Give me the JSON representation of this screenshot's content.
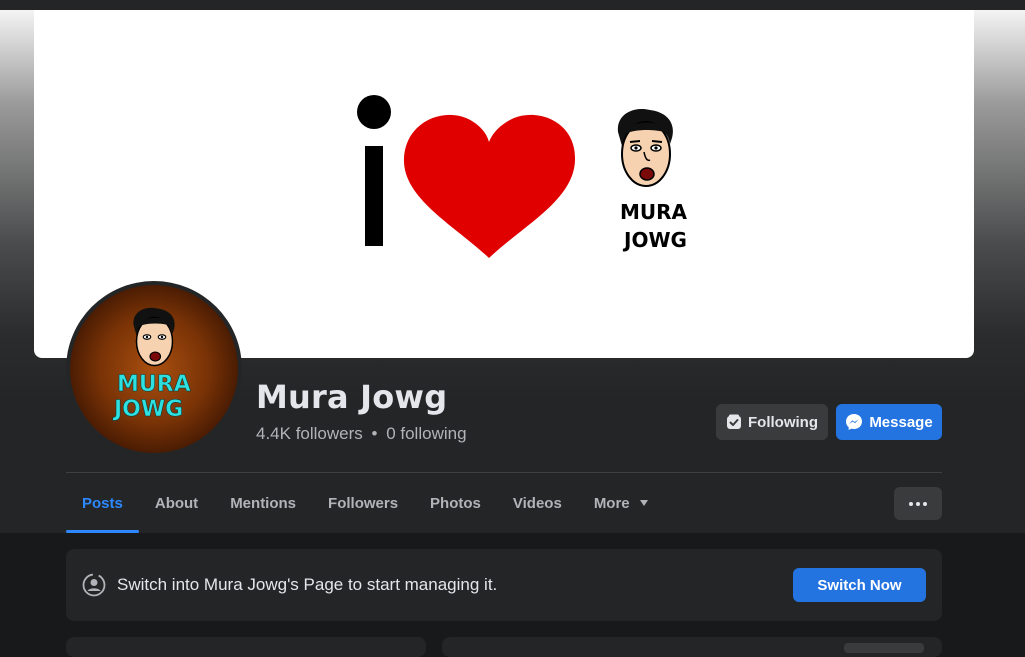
{
  "profile": {
    "name": "Mura Jowg",
    "followers": "4.4K followers",
    "separator": "•",
    "following": "0 following"
  },
  "cover": {
    "letter": "i",
    "logo_line1": "MURA",
    "logo_line2": "JOWG",
    "heart_color": "#e00000"
  },
  "avatar": {
    "logo_line1": "MURA",
    "logo_line2": "JOWG",
    "text_color": "#2ee0e0"
  },
  "actions": {
    "following_label": "Following",
    "message_label": "Message"
  },
  "tabs": [
    {
      "label": "Posts",
      "active": true
    },
    {
      "label": "About"
    },
    {
      "label": "Mentions"
    },
    {
      "label": "Followers"
    },
    {
      "label": "Photos"
    },
    {
      "label": "Videos"
    },
    {
      "label": "More"
    }
  ],
  "notice": {
    "text": "Switch into Mura Jowg's Page to start managing it.",
    "button_label": "Switch Now"
  },
  "colors": {
    "accent": "#2d88ff",
    "button_blue": "#2374e1",
    "surface": "#242526",
    "background": "#18191a"
  }
}
